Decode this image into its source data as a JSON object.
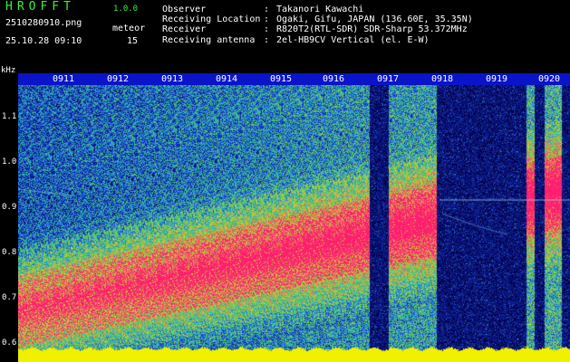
{
  "header": {
    "app_name": "HROFFT",
    "app_version": "1.0.0",
    "filename": "2510280910.png",
    "datetime": "25.10.28 09:10",
    "meteor_label": "meteor",
    "meteor_count": "15"
  },
  "info": [
    {
      "key": "Observer",
      "sep": ":",
      "value": "Takanori Kawachi"
    },
    {
      "key": "Receiving Location",
      "sep": ":",
      "value": "Ogaki, Gifu, JAPAN (136.60E, 35.35N)"
    },
    {
      "key": "Receiver",
      "sep": ":",
      "value": "R820T2(RTL-SDR) SDR-Sharp 53.372MHz"
    },
    {
      "key": "Receiving antenna",
      "sep": ":",
      "value": "2el-HB9CV Vertical (el. E-W)"
    }
  ],
  "axis": {
    "y_unit": "kHz",
    "y_ticks": [
      "1.1",
      "1.0",
      "0.9",
      "0.8",
      "0.7",
      "0.6"
    ],
    "x_ticks": [
      "0911",
      "0912",
      "0913",
      "0914",
      "0915",
      "0916",
      "0917",
      "0918",
      "0919",
      "0920"
    ]
  },
  "colors": {
    "title": "#3cf03c",
    "timebar": "#0a14c8",
    "noise_floor": "#f0f000",
    "signal": "#ff1e6e",
    "background_noise": "#0f1ea0"
  }
}
